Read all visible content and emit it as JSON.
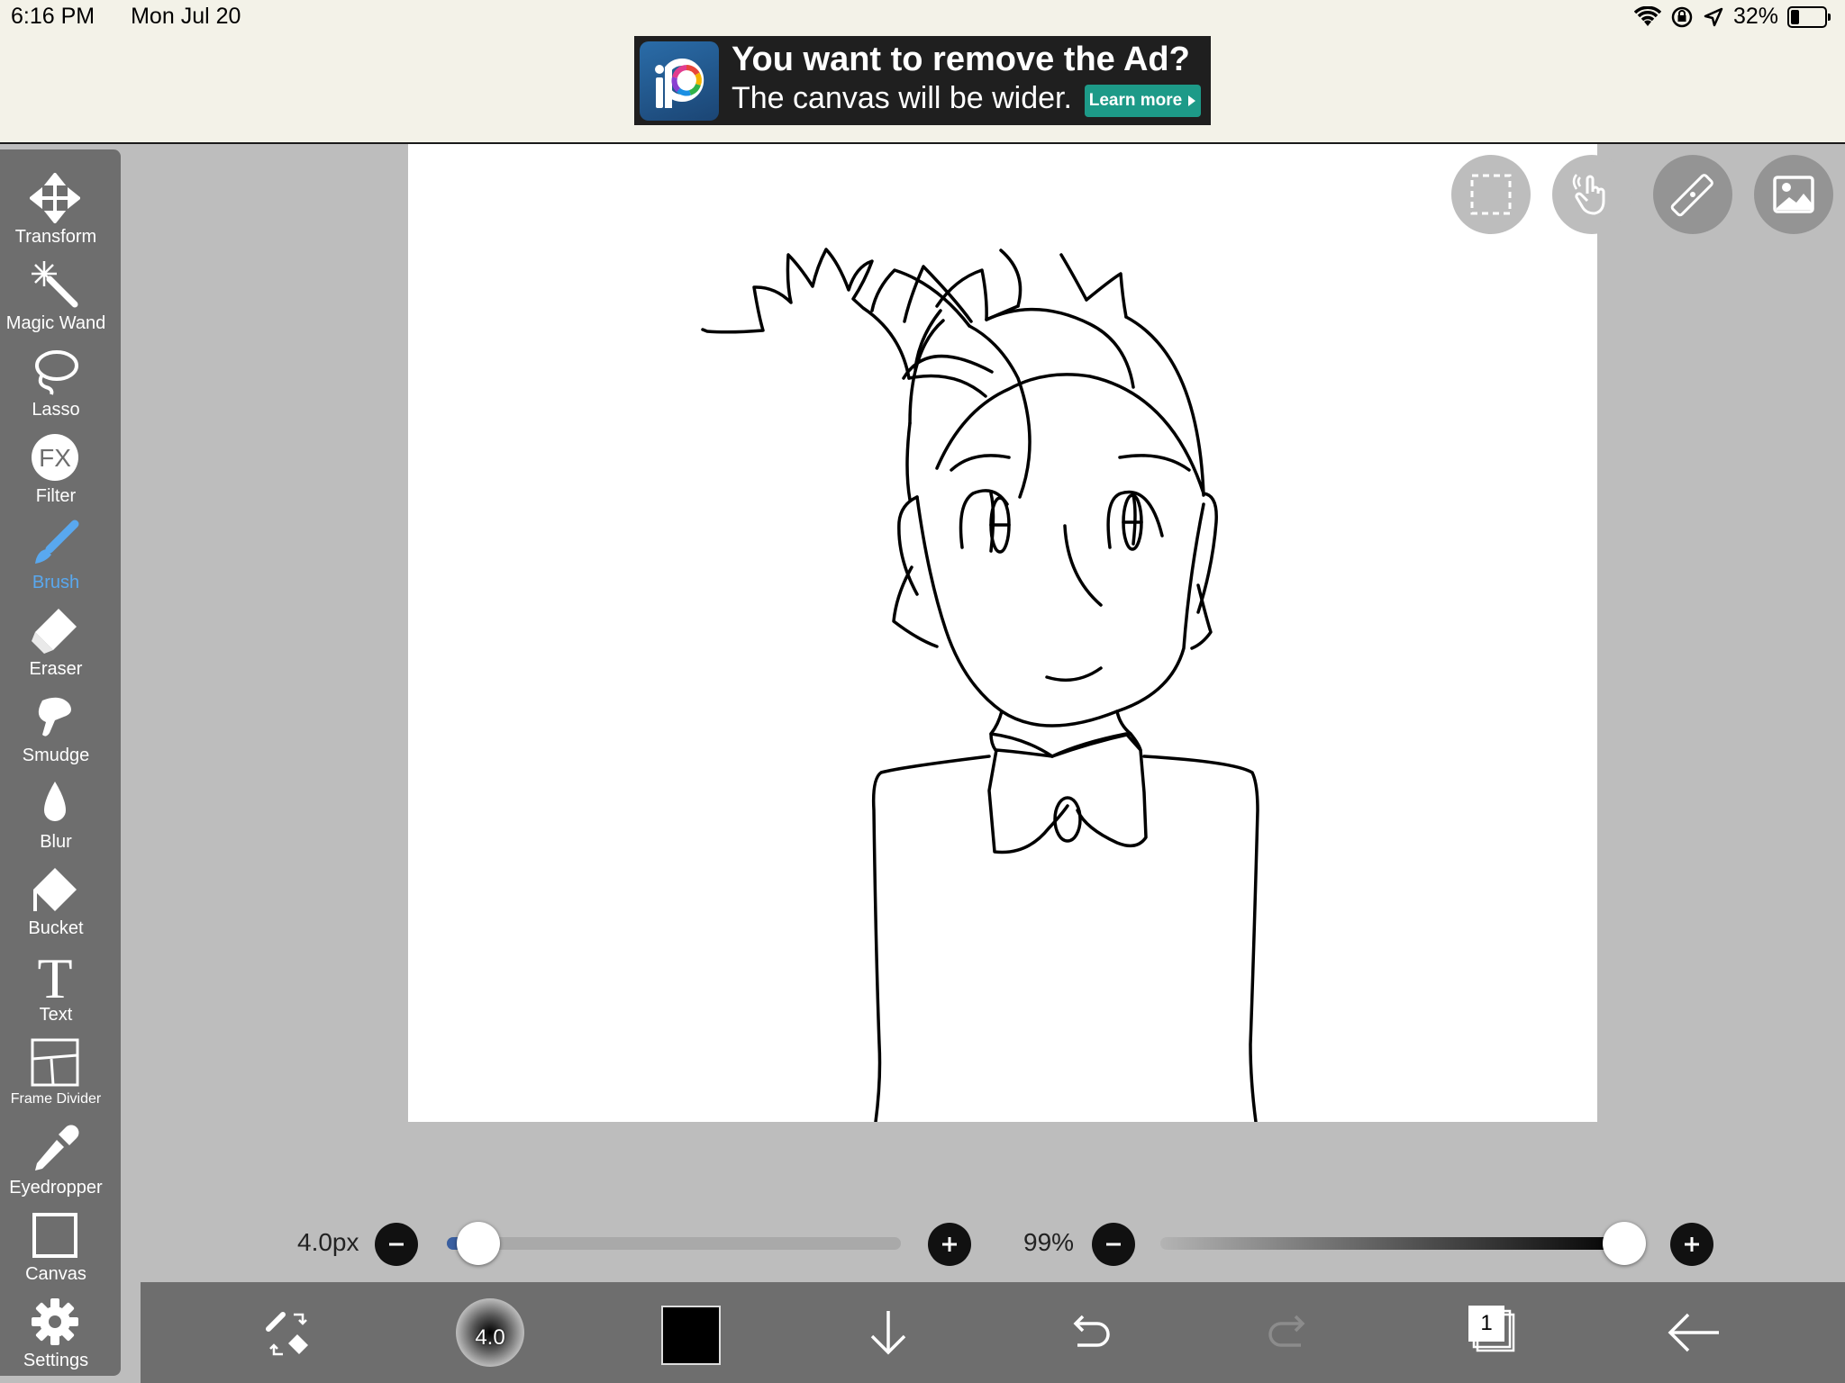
{
  "status_bar": {
    "time": "6:16 PM",
    "date": "Mon Jul 20",
    "battery": "32%"
  },
  "ad": {
    "headline": "You want to remove the Ad?",
    "subline": "The canvas will be wider.",
    "button": "Learn more"
  },
  "toolbar": {
    "active": "Brush",
    "active_color": "#59a8ef",
    "tools": [
      {
        "label": "Transform",
        "icon": "move-arrows-icon"
      },
      {
        "label": "Magic Wand",
        "icon": "magic-wand-icon"
      },
      {
        "label": "Lasso",
        "icon": "lasso-icon"
      },
      {
        "label": "Filter",
        "icon": "fx-icon"
      },
      {
        "label": "Brush",
        "icon": "brush-icon"
      },
      {
        "label": "Eraser",
        "icon": "eraser-icon"
      },
      {
        "label": "Smudge",
        "icon": "smudge-icon"
      },
      {
        "label": "Blur",
        "icon": "droplet-icon"
      },
      {
        "label": "Bucket",
        "icon": "bucket-icon"
      },
      {
        "label": "Text",
        "icon": "text-t-icon"
      },
      {
        "label": "Frame Divider",
        "icon": "frame-divider-icon"
      },
      {
        "label": "Eyedropper",
        "icon": "eyedropper-icon"
      },
      {
        "label": "Canvas",
        "icon": "canvas-square-icon"
      },
      {
        "label": "Settings",
        "icon": "gear-icon"
      }
    ]
  },
  "canvas_buttons": [
    "selection-icon",
    "touch-hand-icon",
    "ruler-icon",
    "image-icon"
  ],
  "brush_size": {
    "label": "4.0px",
    "fraction": 0.07
  },
  "opacity": {
    "label": "99%",
    "fraction": 0.99
  },
  "bottom_bar": {
    "brush_preview_value": "4.0",
    "current_color": "#000000",
    "layer_count": "1",
    "icons": [
      "swap-brush-eraser-icon",
      "brush-preview-icon",
      "color-swatch-icon",
      "arrow-down-icon",
      "undo-icon",
      "redo-icon",
      "layers-icon",
      "back-arrow-icon"
    ]
  }
}
